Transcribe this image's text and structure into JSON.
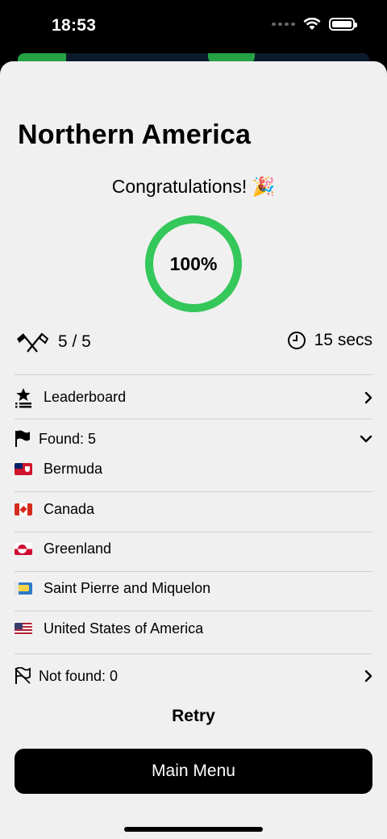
{
  "status_bar": {
    "time": "18:53"
  },
  "quiz": {
    "title": "Northern America",
    "congrats": "Congratulations! 🎉",
    "progress_label": "100%",
    "progress_fraction": 1.0,
    "score": "5 / 5",
    "time": "15 secs"
  },
  "leaderboard": {
    "label": "Leaderboard"
  },
  "found": {
    "label": "Found: 5",
    "countries": [
      {
        "name": "Bermuda"
      },
      {
        "name": "Canada"
      },
      {
        "name": "Greenland"
      },
      {
        "name": "Saint Pierre and Miquelon"
      },
      {
        "name": "United States of America"
      }
    ]
  },
  "not_found": {
    "label": "Not found: 0"
  },
  "actions": {
    "retry": "Retry",
    "main_menu": "Main Menu"
  },
  "colors": {
    "accent_green": "#34c759",
    "sheet_bg": "#f0f0f0",
    "button_bg": "#000000"
  },
  "icons": {
    "score": "crossed-flags-icon",
    "time": "clock-icon",
    "leaderboard": "leaderboard-star-icon",
    "found": "flag-icon",
    "not_found": "flag-outline-icon"
  }
}
